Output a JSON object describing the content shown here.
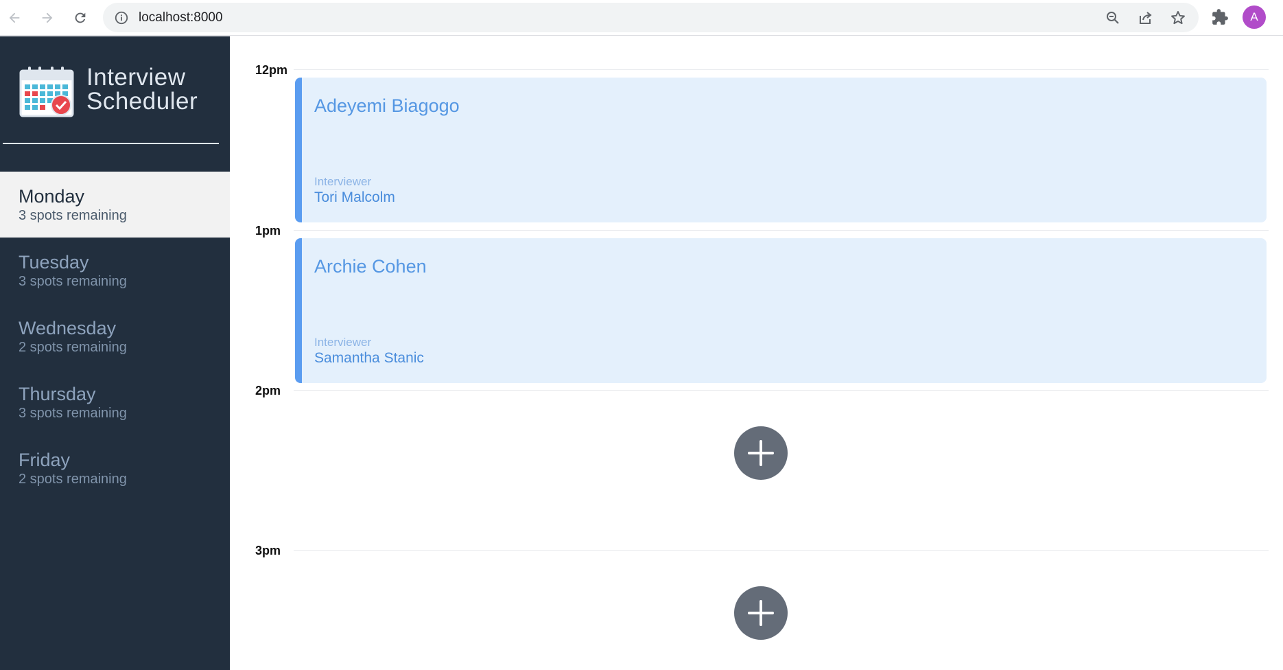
{
  "browser": {
    "url": "localhost:8000",
    "profile_initial": "A",
    "icons": [
      "back-arrow-icon",
      "forward-arrow-icon",
      "reload-icon",
      "info-icon",
      "zoom-icon",
      "share-icon",
      "star-icon",
      "extensions-puzzle-icon"
    ]
  },
  "app": {
    "title_line1": "Interview",
    "title_line2": "Scheduler",
    "colors": {
      "sidebar": "#222f3e",
      "selected_day": "#f2f2f2",
      "appointment_bg": "#e4f0fc",
      "appointment_accent": "#5a9cf0",
      "add_button": "#646c78"
    }
  },
  "days": [
    {
      "name": "Monday",
      "spots": "3 spots remaining",
      "selected": true
    },
    {
      "name": "Tuesday",
      "spots": "3 spots remaining",
      "selected": false
    },
    {
      "name": "Wednesday",
      "spots": "2 spots remaining",
      "selected": false
    },
    {
      "name": "Thursday",
      "spots": "3 spots remaining",
      "selected": false
    },
    {
      "name": "Friday",
      "spots": "2 spots remaining",
      "selected": false
    }
  ],
  "schedule": {
    "slots": [
      {
        "time": "12pm",
        "student": "Adeyemi Biagogo",
        "interviewer_label": "Interviewer",
        "interviewer": "Tori Malcolm"
      },
      {
        "time": "1pm",
        "student": "Archie Cohen",
        "interviewer_label": "Interviewer",
        "interviewer": "Samantha Stanic"
      },
      {
        "time": "2pm"
      },
      {
        "time": "3pm"
      }
    ]
  }
}
